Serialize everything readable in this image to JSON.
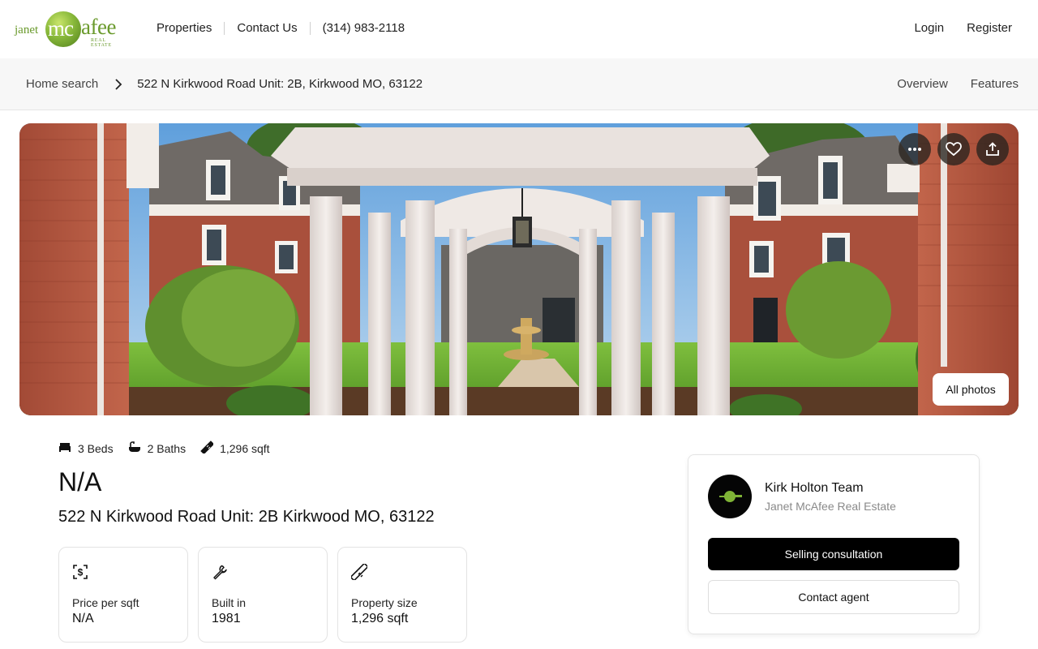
{
  "brand": {
    "logo_alt": "Janet McAfee Real Estate",
    "logo_text": {
      "first": "janet",
      "mc": "mc",
      "afee": "afee",
      "tag": "REAL ESTATE"
    }
  },
  "header": {
    "nav": [
      {
        "label": "Properties"
      },
      {
        "label": "Contact Us"
      },
      {
        "label": "(314) 983-2118"
      }
    ],
    "login_label": "Login",
    "register_label": "Register"
  },
  "breadcrumb": {
    "home": "Home search",
    "current": "522 N Kirkwood Road Unit: 2B, Kirkwood MO, 63122",
    "tabs": [
      {
        "label": "Overview"
      },
      {
        "label": "Features"
      }
    ]
  },
  "gallery": {
    "more_icon": "more-horizontal-icon",
    "favorite_icon": "heart-icon",
    "share_icon": "share-icon",
    "all_photos_label": "All photos"
  },
  "listing": {
    "beds": "3 Beds",
    "baths": "2 Baths",
    "sqft": "1,296 sqft",
    "price": "N/A",
    "address": "522 N Kirkwood Road Unit: 2B Kirkwood MO, 63122",
    "stats": [
      {
        "icon": "dollar-icon",
        "label": "Price per sqft",
        "value": "N/A"
      },
      {
        "icon": "wrench-icon",
        "label": "Built in",
        "value": "1981"
      },
      {
        "icon": "ruler-icon",
        "label": "Property size",
        "value": "1,296 sqft"
      }
    ]
  },
  "agent": {
    "name": "Kirk Holton Team",
    "company": "Janet McAfee Real Estate",
    "primary_cta": "Selling consultation",
    "secondary_cta": "Contact agent"
  },
  "colors": {
    "brand_green": "#6a9a2c",
    "primary_button": "#000000",
    "breadcrumb_bg": "#f7f7f7"
  }
}
